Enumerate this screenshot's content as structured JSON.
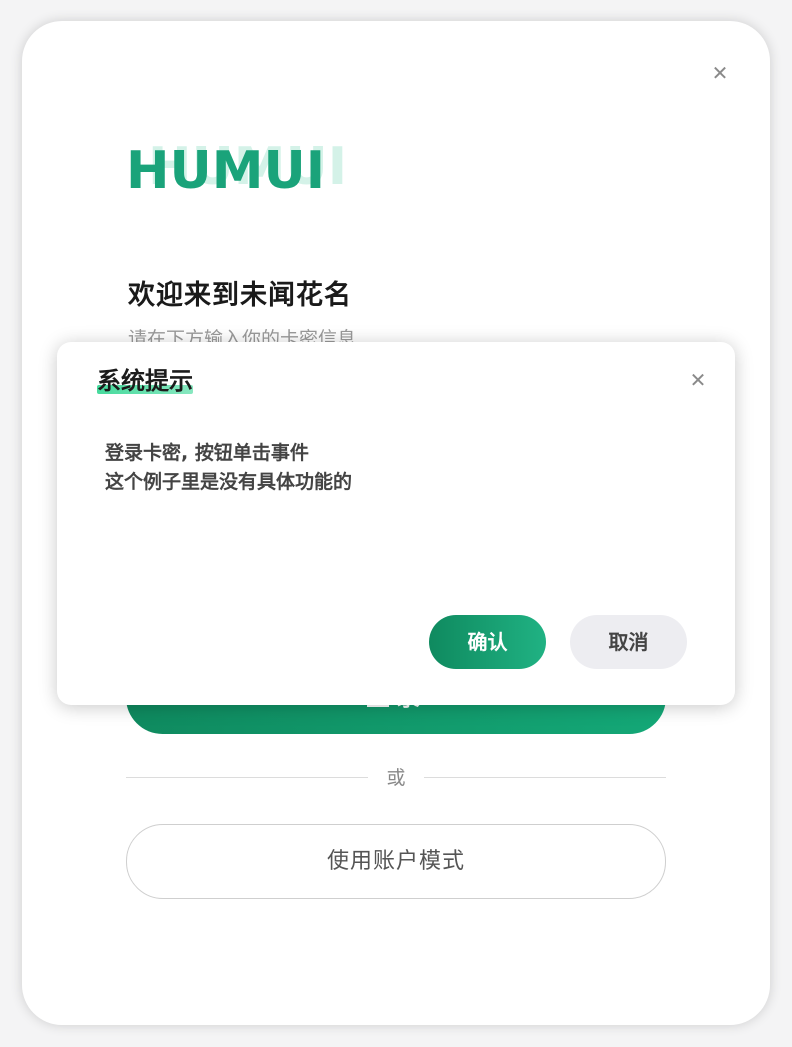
{
  "logo": {
    "text": "HUMUI",
    "color": "#1aa37a"
  },
  "card": {
    "close_icon": "close-icon",
    "title": "欢迎来到未闻花名",
    "subtitle": "请在下方输入你的卡密信息",
    "login_label": "登录",
    "divider_text": "或",
    "account_mode_label": "使用账户模式"
  },
  "dialog": {
    "title": "系统提示",
    "close_icon": "close-icon",
    "message_line1": "登录卡密, 按钮单击事件",
    "message_line2": "这个例子里是没有具体功能的",
    "confirm_label": "确认",
    "cancel_label": "取消"
  },
  "colors": {
    "accent": "#14a877",
    "accent_dark": "#0f8a5f",
    "highlight": "#26d48c",
    "cancel_bg": "#ededf1"
  }
}
